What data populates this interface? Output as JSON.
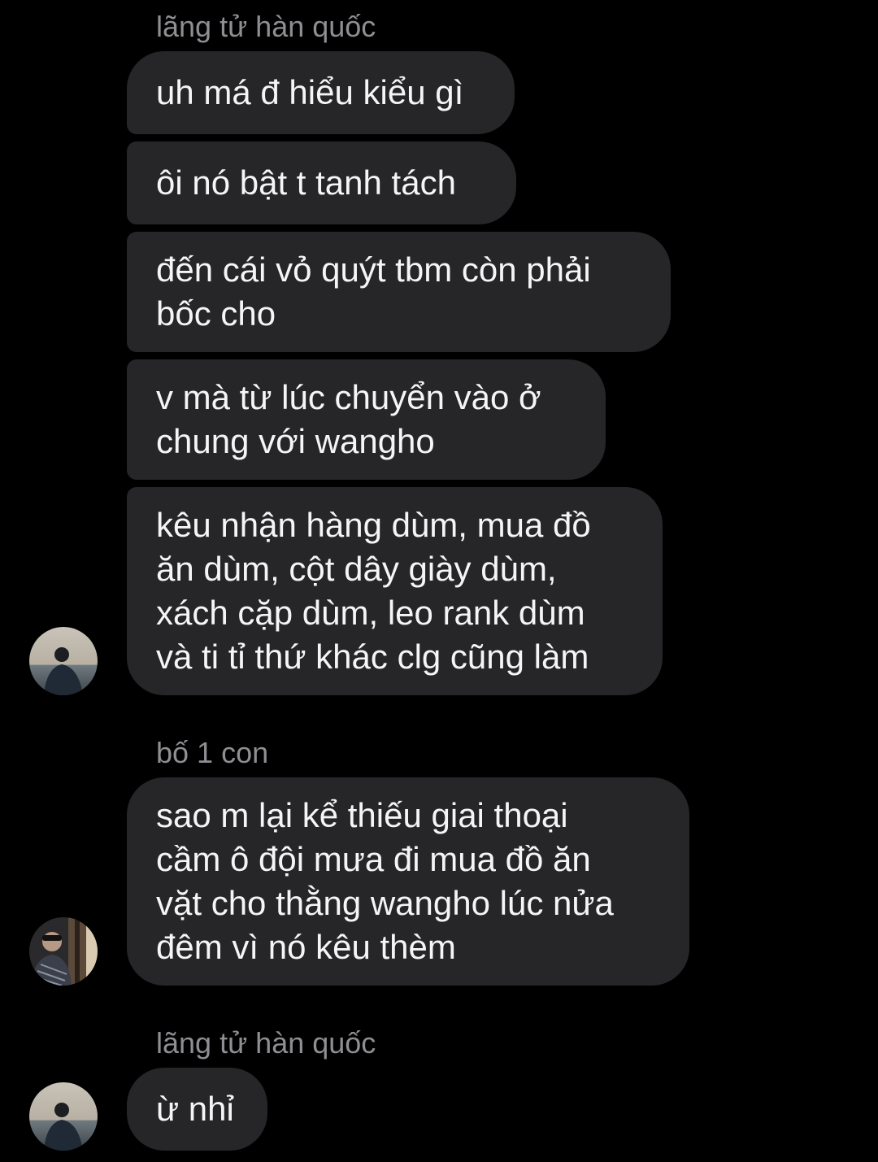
{
  "colors": {
    "background": "#000000",
    "bubble": "#262628",
    "text": "#f5f5f5",
    "sender_name": "#8e8e93"
  },
  "groups": [
    {
      "sender": "lãng tử hàn quốc",
      "avatar_icon": "profile-photo-person-by-sea",
      "messages": [
        "uh má đ hiểu kiểu gì",
        "ôi nó bật t tanh tách",
        "đến cái vỏ quýt tbm còn phải\nbốc cho",
        "v mà từ lúc chuyển vào ở\nchung với wangho",
        "kêu nhận hàng dùm, mua đồ\năn dùm, cột dây giày dùm,\nxách cặp dùm, leo rank dùm\nvà ti tỉ thứ khác clg cũng làm"
      ]
    },
    {
      "sender": "bố 1 con",
      "avatar_icon": "profile-photo-person-with-sunglasses",
      "messages": [
        "sao m lại kể thiếu giai thoại\ncầm ô đội mưa đi mua đồ ăn\nvặt cho thằng wangho lúc nửa\nđêm vì nó kêu thèm"
      ]
    },
    {
      "sender": "lãng tử hàn quốc",
      "avatar_icon": "profile-photo-person-by-sea",
      "messages": [
        "ừ nhỉ"
      ]
    }
  ]
}
